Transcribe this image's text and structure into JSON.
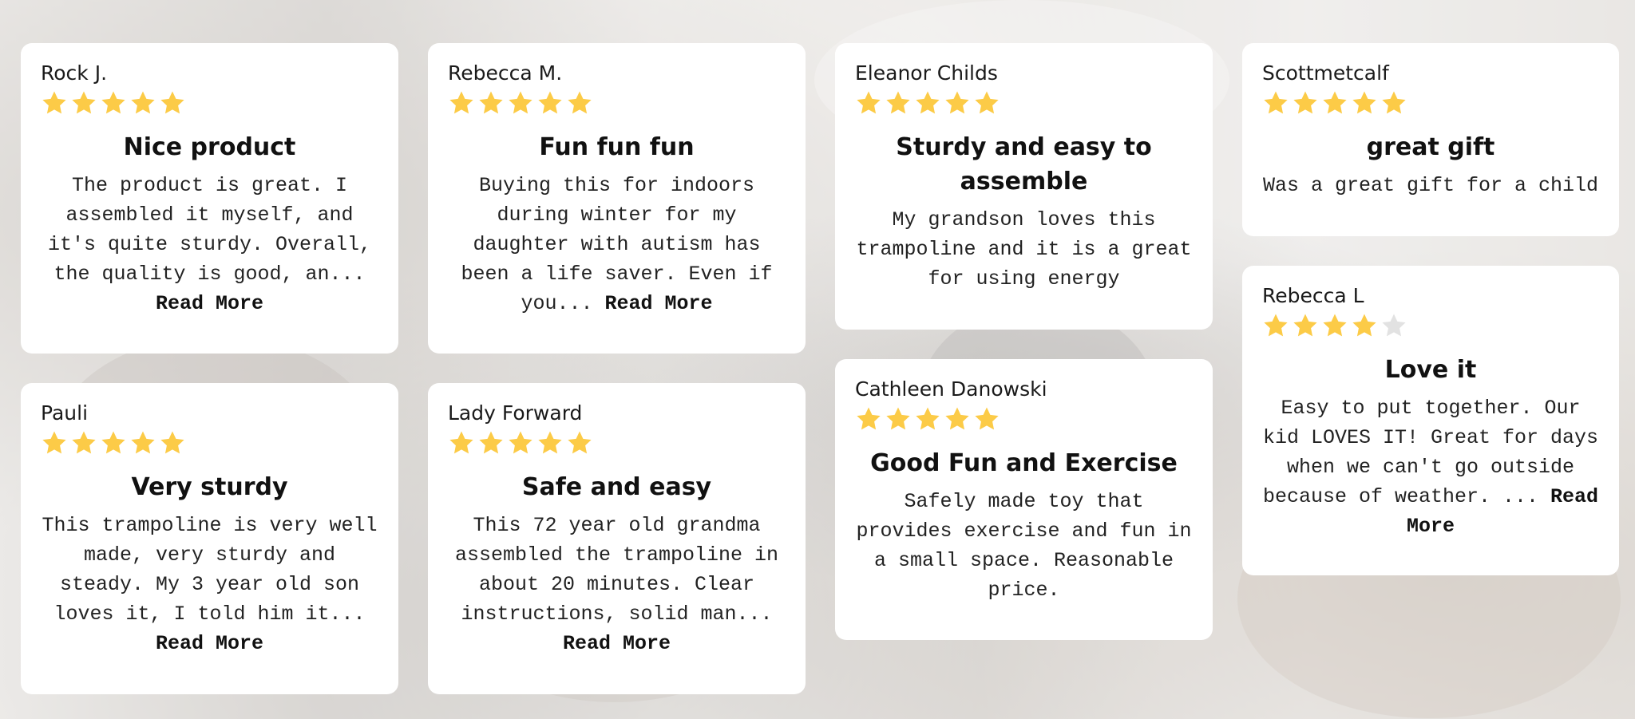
{
  "colors": {
    "star_filled": "#FCCB47",
    "star_empty": "#E2E2E2",
    "card_bg": "#FFFFFF"
  },
  "reviews": [
    {
      "author": "Rock J.",
      "rating": 5,
      "title": "Nice product",
      "body": "The product is great. I assembled it myself, and it's quite sturdy. Overall, the quality is good, an...",
      "more": "Read More"
    },
    {
      "author": "Rebecca M.",
      "rating": 5,
      "title": "Fun fun fun",
      "body": "Buying this for indoors during winter for my daughter with autism has been a life saver. Even if you...",
      "more": "Read More"
    },
    {
      "author": "Eleanor Childs",
      "rating": 5,
      "title": "Sturdy and easy to assemble",
      "body": "My grandson loves this trampoline and it is a great for using energy",
      "more": ""
    },
    {
      "author": "Scottmetcalf",
      "rating": 5,
      "title": "great gift",
      "body": "Was a great gift for a child",
      "more": ""
    },
    {
      "author": "Pauli",
      "rating": 5,
      "title": "Very sturdy",
      "body": "This trampoline is very well made, very sturdy and steady. My 3 year old son loves it, I told him it...",
      "more": "Read More"
    },
    {
      "author": "Lady Forward",
      "rating": 5,
      "title": "Safe and easy",
      "body": "This 72 year old grandma assembled the trampoline in about 20 minutes. Clear instructions, solid man...",
      "more": "Read More"
    },
    {
      "author": "Cathleen Danowski",
      "rating": 5,
      "title": "Good Fun and Exercise",
      "body": "Safely made toy that provides exercise and fun in a small space. Reasonable price.",
      "more": ""
    },
    {
      "author": "Rebecca L",
      "rating": 4,
      "title": "Love it",
      "body": "Easy to put together. Our kid LOVES IT! Great for days when we can't go outside because of weather. ...",
      "more": "Read More"
    }
  ]
}
